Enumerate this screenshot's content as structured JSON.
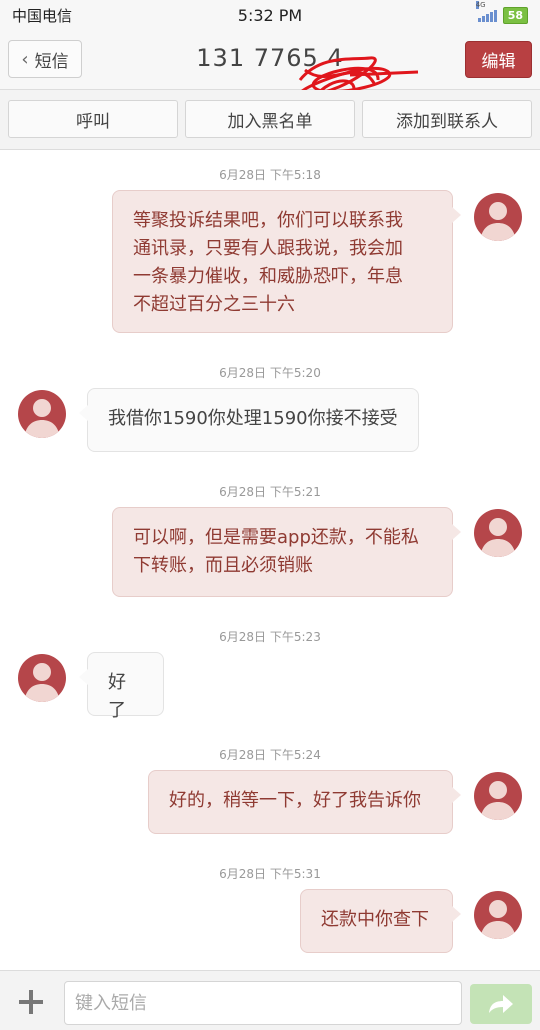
{
  "status_bar": {
    "carrier": "中国电信",
    "time": "5:32 PM",
    "network": "4G",
    "battery": "58"
  },
  "header": {
    "back_label": "短信",
    "contact_number": "131 7765 4",
    "edit_label": "编辑"
  },
  "actions": {
    "call": "呼叫",
    "blacklist": "加入黑名单",
    "add_contact": "添加到联系人"
  },
  "messages": [
    {
      "direction": "sent",
      "timestamp": "6月28日 下午5:18",
      "lines": [
        "等聚投诉结果吧，你们可以联系我",
        "通讯录，只要有人跟我说，我会加",
        "一条暴力催收，和威胁恐吓，年息",
        "不超过百分之三十六"
      ]
    },
    {
      "direction": "received",
      "timestamp": "6月28日 下午5:20",
      "lines": [
        "我借你1590你处理1590你接不接受"
      ]
    },
    {
      "direction": "sent",
      "timestamp": "6月28日 下午5:21",
      "lines": [
        "可以啊，但是需要app还款，不能私",
        "下转账，而且必须销账"
      ]
    },
    {
      "direction": "received",
      "timestamp": "6月28日 下午5:23",
      "lines": [
        "好了"
      ]
    },
    {
      "direction": "sent",
      "timestamp": "6月28日 下午5:24",
      "lines": [
        "好的，稍等一下，好了我告诉你"
      ]
    },
    {
      "direction": "sent",
      "timestamp": "6月28日 下午5:31",
      "lines": [
        "还款中你查下"
      ]
    }
  ],
  "composer": {
    "placeholder": "键入短信",
    "value": ""
  },
  "colors": {
    "accent": "#b84042",
    "sent_bubble": "#f5e7e5",
    "sent_text": "#8f3a32",
    "received_bubble": "#fafafa",
    "send_button": "#c4e3b6"
  }
}
